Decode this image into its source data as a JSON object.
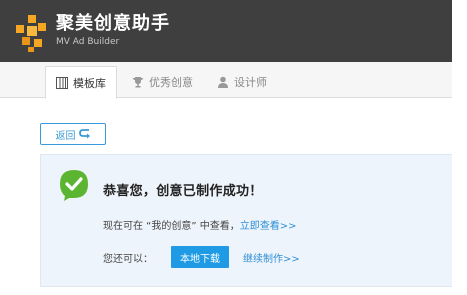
{
  "brand": {
    "title": "聚美创意助手",
    "subtitle": "MV Ad Builder"
  },
  "tabs": [
    {
      "label": "模板库",
      "icon": "template-grid-icon",
      "active": true
    },
    {
      "label": "优秀创意",
      "icon": "trophy-icon",
      "active": false
    },
    {
      "label": "设计师",
      "icon": "user-icon",
      "active": false
    }
  ],
  "back_button": {
    "label": "返回",
    "icon": "return-arrow-icon"
  },
  "success": {
    "title": "恭喜您，创意已制作成功！",
    "view_prefix": "现在可在 “我的创意” 中查看，",
    "view_link": "立即查看>>",
    "also_label": "您还可以：",
    "download_button": "本地下载",
    "continue_link": "继续制作>>"
  },
  "colors": {
    "header_bg": "#3f3f40",
    "logo": "#f5a623",
    "accent": "#1e9be4",
    "success_green": "#5cb531",
    "panel_bg": "#eef4fb"
  }
}
